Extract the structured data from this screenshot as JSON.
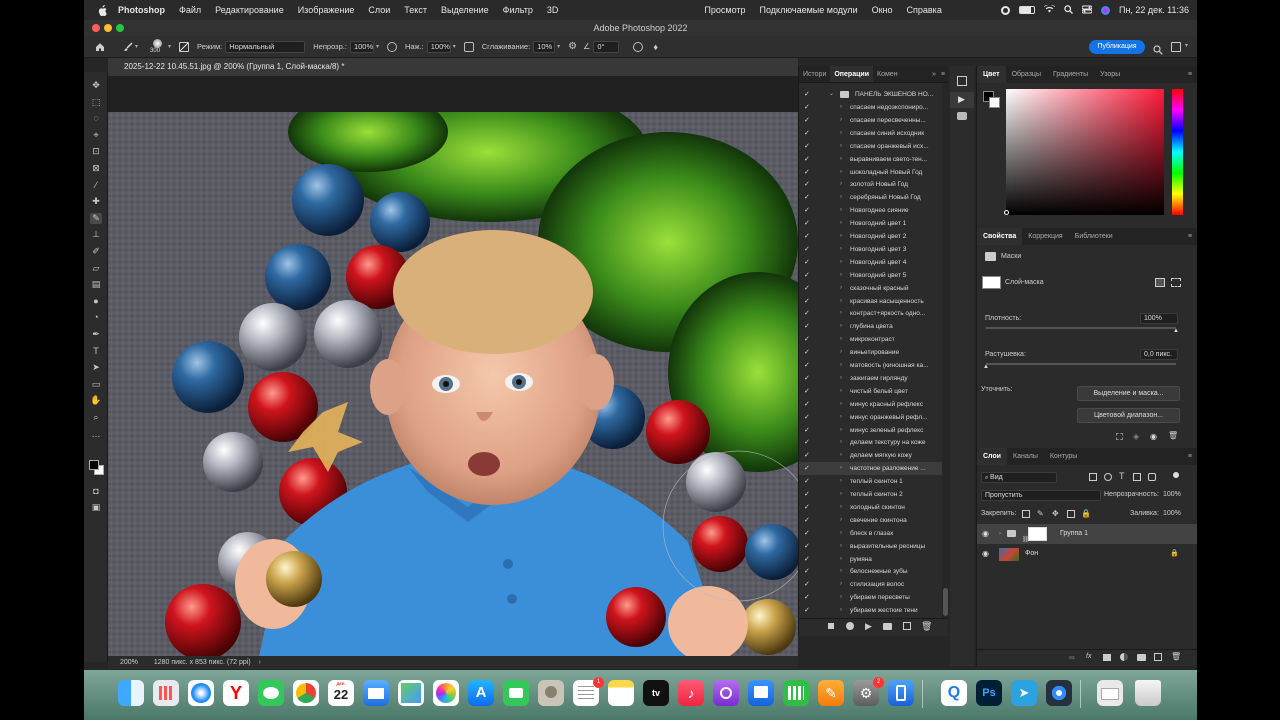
{
  "menubar": {
    "app": "Photoshop",
    "items": [
      "Файл",
      "Редактирование",
      "Изображение",
      "Слои",
      "Текст",
      "Выделение",
      "Фильтр",
      "3D",
      "Просмотр",
      "Подключаемые модули",
      "Окно",
      "Справка"
    ],
    "clock": "Пн, 22 дек.  11:36"
  },
  "window": {
    "title": "Adobe Photoshop 2022"
  },
  "options": {
    "brush_size": "300",
    "mode_label": "Режим:",
    "mode_value": "Нормальный",
    "opacity_label": "Непрозр.:",
    "opacity_value": "100%",
    "pressure_label": "Наж.:",
    "pressure_value": "100%",
    "smoothing_label": "Сглаживание:",
    "smoothing_value": "10%",
    "angle_value": "0°",
    "publish": "Публикация"
  },
  "document": {
    "tab": "2025-12-22 10.45.51.jpg @ 200% (Группа 1, Слой-маска/8) *",
    "zoom": "200%",
    "info": "1280 пикс. x 853 пикс. (72 ppi)"
  },
  "actions_panel": {
    "tabs": [
      "Истори",
      "Операции",
      "Комен"
    ],
    "active_tab": "Операции",
    "set_name": "ПАНЕЛЬ ЭКШЕНОВ НО...",
    "selected_index": 28,
    "items": [
      "спасаем недоэкспониро...",
      "спасаем пересвеченны...",
      "спасаем синий исходник",
      "спасаем оранжевый исх...",
      "выравниваем свето-тен...",
      "шоколадный Новый Год",
      "золотой Новый Год",
      "серебряный Новый Год",
      "Новогоднее сияние",
      "Новогодний цвет 1",
      "Новогодний цвет 2",
      "Новогодний цвет 3",
      "Новогодний цвет 4",
      "Новогодний цвет 5",
      "сказочный красный",
      "красивая насыщенность",
      "контраст+яркость одно...",
      "глубина цвета",
      "микроконтраст",
      "виньетирование",
      "матовость (киношная ка...",
      "зажигаем гирлянду",
      "чистый белый цвет",
      "минус красный рефлекс",
      "минус оранжевый рефл...",
      "минус зеленый рефлекс",
      "делаем текстуру на коже",
      "делаем мягкую кожу",
      "частотное разложение ...",
      "теплый скинтон 1",
      "теплый скинтон 2",
      "холодный скинтон",
      "свечение скинтона",
      "блеск в глазах",
      "выразительные ресницы",
      "румяна",
      "белоснежные зубы",
      "стилизация волос",
      "убираем пересветы",
      "убираем жесткие тени"
    ]
  },
  "color_panel": {
    "tabs": [
      "Цвет",
      "Образцы",
      "Градиенты",
      "Узоры"
    ],
    "hue_color": "#ff1a3a"
  },
  "properties_panel": {
    "tabs": [
      "Свойства",
      "Коррекция",
      "Библиотеки"
    ],
    "masks_label": "Маски",
    "mask_name": "Слой-маска",
    "density_label": "Плотность:",
    "density_value": "100%",
    "density_level": 1.0,
    "feather_label": "Растушевка:",
    "feather_value": "0,0 пикс.",
    "feather_level": 0.0,
    "refine_label": "Уточнить:",
    "select_mask_btn": "Выделение и маска...",
    "color_range_btn": "Цветовой диапазон..."
  },
  "layers_panel": {
    "tabs": [
      "Слои",
      "Каналы",
      "Контуры"
    ],
    "filter_label": "Вид",
    "blend_mode": "Пропустить",
    "opacity_label": "Непрозрачность:",
    "opacity_value": "100%",
    "lock_label": "Закрепить:",
    "fill_label": "Заливка:",
    "fill_value": "100%",
    "layers": [
      {
        "name": "Группа 1"
      },
      {
        "name": "Фон"
      }
    ]
  },
  "dock": {
    "calendar_month": "ДЕК.",
    "calendar_day": "22",
    "reminders_badge": "1",
    "settings_badge": "2",
    "ps_label": "Ps"
  }
}
